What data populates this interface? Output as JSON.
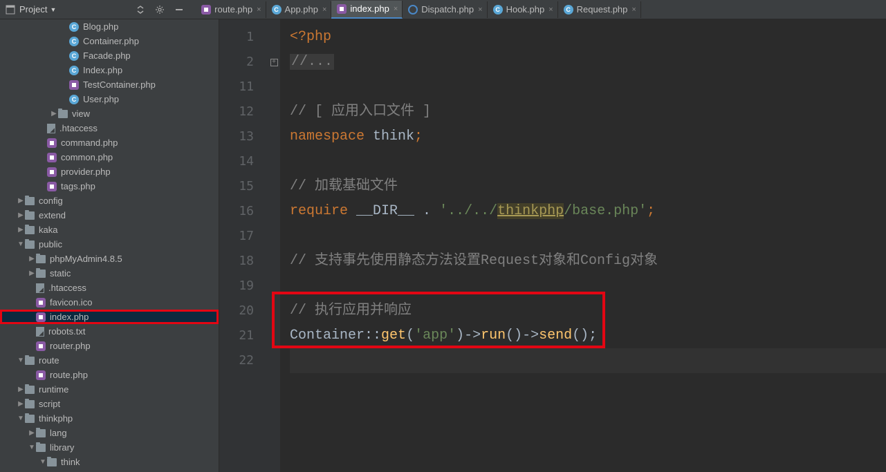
{
  "project_button": "Project",
  "tabs": [
    {
      "label": "route.php",
      "icon": "g",
      "active": false
    },
    {
      "label": "App.php",
      "icon": "c",
      "active": false
    },
    {
      "label": "index.php",
      "icon": "g",
      "active": true
    },
    {
      "label": "Dispatch.php",
      "icon": "d",
      "active": false
    },
    {
      "label": "Hook.php",
      "icon": "c",
      "active": false
    },
    {
      "label": "Request.php",
      "icon": "c",
      "active": false
    }
  ],
  "tree": [
    {
      "indent": 5,
      "arrow": "",
      "icon": "c",
      "label": "Blog.php"
    },
    {
      "indent": 5,
      "arrow": "",
      "icon": "c",
      "label": "Container.php"
    },
    {
      "indent": 5,
      "arrow": "",
      "icon": "c",
      "label": "Facade.php"
    },
    {
      "indent": 5,
      "arrow": "",
      "icon": "c",
      "label": "Index.php"
    },
    {
      "indent": 5,
      "arrow": "",
      "icon": "g",
      "label": "TestContainer.php"
    },
    {
      "indent": 5,
      "arrow": "",
      "icon": "c",
      "label": "User.php"
    },
    {
      "indent": 4,
      "arrow": "▶",
      "icon": "folder",
      "label": "view"
    },
    {
      "indent": 3,
      "arrow": "",
      "icon": "file",
      "label": ".htaccess"
    },
    {
      "indent": 3,
      "arrow": "",
      "icon": "g",
      "label": "command.php"
    },
    {
      "indent": 3,
      "arrow": "",
      "icon": "g",
      "label": "common.php"
    },
    {
      "indent": 3,
      "arrow": "",
      "icon": "g",
      "label": "provider.php"
    },
    {
      "indent": 3,
      "arrow": "",
      "icon": "g",
      "label": "tags.php"
    },
    {
      "indent": 1,
      "arrow": "▶",
      "icon": "folder",
      "label": "config"
    },
    {
      "indent": 1,
      "arrow": "▶",
      "icon": "folder",
      "label": "extend"
    },
    {
      "indent": 1,
      "arrow": "▶",
      "icon": "folder",
      "label": "kaka"
    },
    {
      "indent": 1,
      "arrow": "▼",
      "icon": "folder",
      "label": "public"
    },
    {
      "indent": 2,
      "arrow": "▶",
      "icon": "folder",
      "label": "phpMyAdmin4.8.5"
    },
    {
      "indent": 2,
      "arrow": "▶",
      "icon": "folder",
      "label": "static"
    },
    {
      "indent": 2,
      "arrow": "",
      "icon": "file",
      "label": ".htaccess"
    },
    {
      "indent": 2,
      "arrow": "",
      "icon": "g",
      "label": "favicon.ico"
    },
    {
      "indent": 2,
      "arrow": "",
      "icon": "g",
      "label": "index.php",
      "selected": true,
      "highlighted": true
    },
    {
      "indent": 2,
      "arrow": "",
      "icon": "file",
      "label": "robots.txt"
    },
    {
      "indent": 2,
      "arrow": "",
      "icon": "g",
      "label": "router.php"
    },
    {
      "indent": 1,
      "arrow": "▼",
      "icon": "folder",
      "label": "route"
    },
    {
      "indent": 2,
      "arrow": "",
      "icon": "g",
      "label": "route.php"
    },
    {
      "indent": 1,
      "arrow": "▶",
      "icon": "folder",
      "label": "runtime"
    },
    {
      "indent": 1,
      "arrow": "▶",
      "icon": "folder",
      "label": "script"
    },
    {
      "indent": 1,
      "arrow": "▼",
      "icon": "folder",
      "label": "thinkphp"
    },
    {
      "indent": 2,
      "arrow": "▶",
      "icon": "folder",
      "label": "lang"
    },
    {
      "indent": 2,
      "arrow": "▼",
      "icon": "folder",
      "label": "library"
    },
    {
      "indent": 3,
      "arrow": "▼",
      "icon": "folder",
      "label": "think"
    }
  ],
  "line_numbers": [
    "1",
    "2",
    "11",
    "12",
    "13",
    "14",
    "15",
    "16",
    "17",
    "18",
    "19",
    "20",
    "21",
    "22"
  ],
  "code": {
    "l1_open": "<?php",
    "l2_comment": "//...",
    "l12_comment": "// [ 应用入口文件 ]",
    "l13_kw": "namespace",
    "l13_ns": " think",
    "l13_semi": ";",
    "l15_comment": "// 加载基础文件",
    "l16_kw": "require",
    "l16_dir": " __DIR__ ",
    "l16_dot": ". ",
    "l16_s1": "'../../",
    "l16_link": "thinkphp",
    "l16_s2": "/base.php'",
    "l16_semi": ";",
    "l18_comment": "// 支持事先使用静态方法设置Request对象和Config对象",
    "l20_comment": "// 执行应用并响应",
    "l21_class": "Container",
    "l21_cc": "::",
    "l21_get": "get",
    "l21_p1": "(",
    "l21_app": "'app'",
    "l21_p2": ")->",
    "l21_run": "run",
    "l21_p3": "()->",
    "l21_send": "send",
    "l21_p4": "();"
  }
}
